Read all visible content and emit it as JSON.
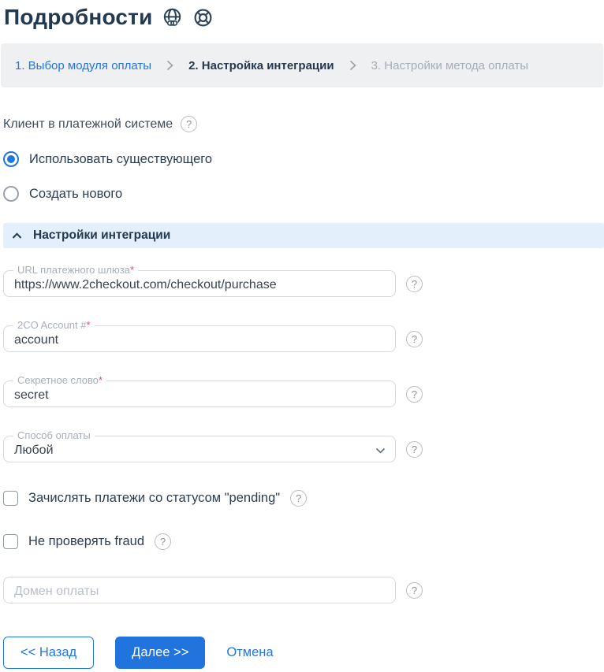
{
  "header": {
    "title": "Подробности"
  },
  "icons": {
    "help_glyph": "?"
  },
  "steps": [
    {
      "label": "1. Выбор модуля оплаты"
    },
    {
      "label": "2. Настройка интеграции"
    },
    {
      "label": "3. Настройки метода оплаты"
    }
  ],
  "client": {
    "label": "Клиент в платежной системе",
    "options": [
      {
        "label": "Использовать существующего",
        "selected": true
      },
      {
        "label": "Создать нового",
        "selected": false
      }
    ]
  },
  "integration": {
    "section_title": "Настройки интеграции",
    "required_mark": "*",
    "fields": [
      {
        "label": "URL платежного шлюза",
        "value": "https://www.2checkout.com/checkout/purchase"
      },
      {
        "label": "2CO Account #",
        "value": "account"
      },
      {
        "label": "Секретное слово",
        "value": "secret"
      }
    ],
    "select": {
      "label": "Способ оплаты",
      "value": "Любой"
    },
    "checkboxes": [
      {
        "label": "Зачислять платежи со статусом \"pending\"",
        "checked": false
      },
      {
        "label": "Не проверять fraud",
        "checked": false
      }
    ],
    "domain": {
      "placeholder": "Домен оплаты",
      "value": ""
    }
  },
  "footer": {
    "back": "<< Назад",
    "next": "Далее >>",
    "cancel": "Отмена"
  },
  "colors": {
    "accent_blue": "#2176de",
    "dark_navy": "#233950",
    "section_bg": "#e4effc",
    "steps_bg": "#eff0f2",
    "muted_gray": "#a6adb8",
    "required_pink": "#e83e8c"
  }
}
